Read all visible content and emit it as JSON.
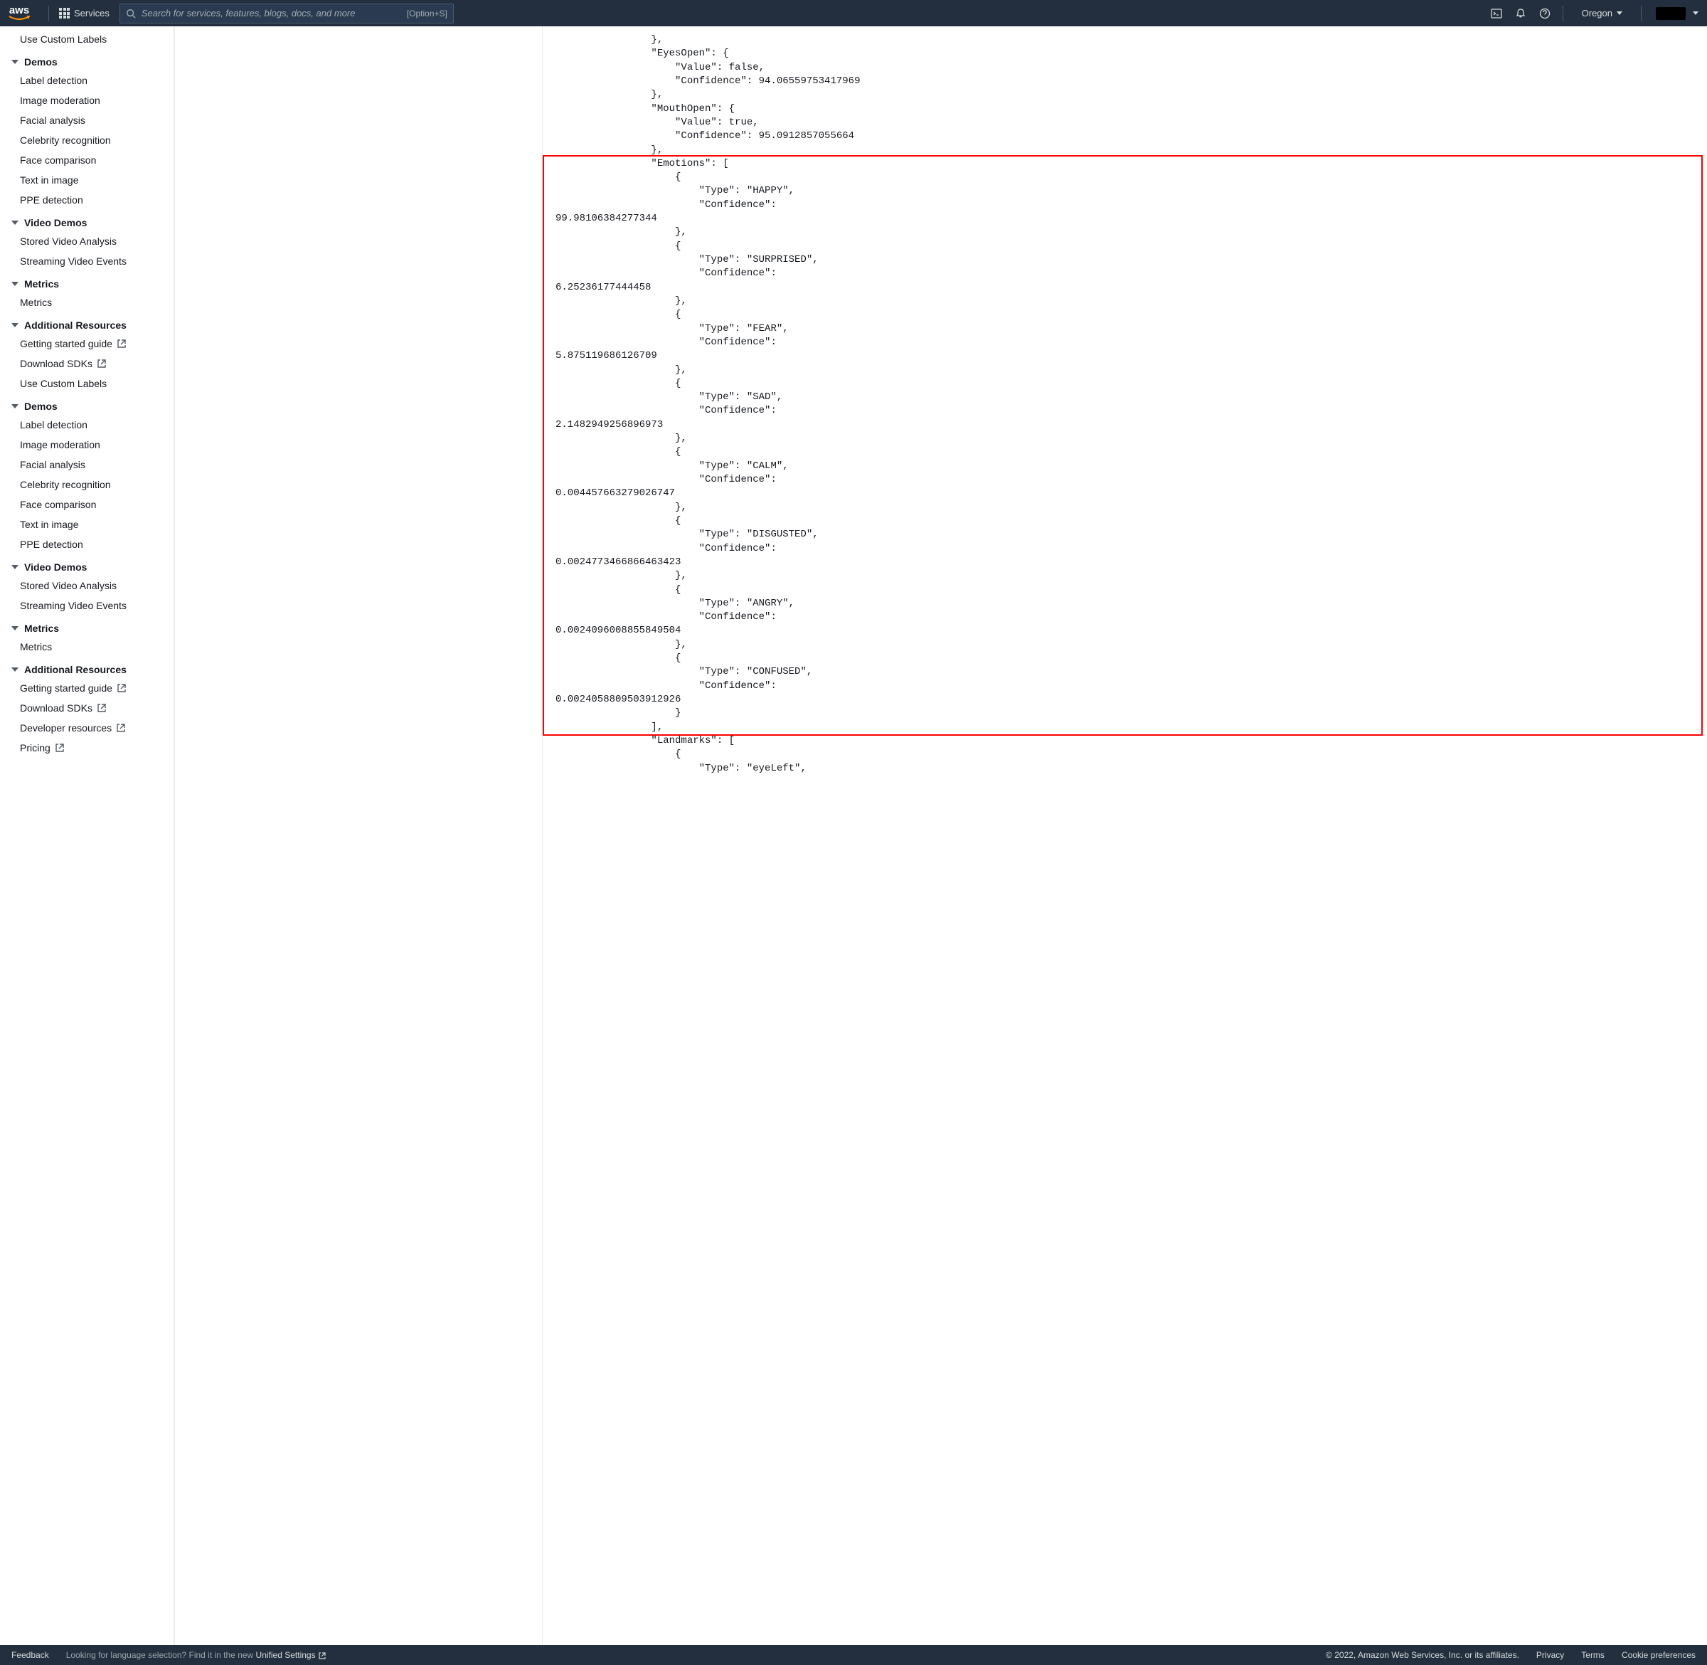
{
  "topnav": {
    "logo_text": "aws",
    "services_label": "Services",
    "search_placeholder": "Search for services, features, blogs, docs, and more",
    "search_hint": "[Option+S]",
    "region": "Oregon"
  },
  "sidebar_sections": [
    {
      "type": "item",
      "label": "Use Custom Labels",
      "ext": false
    },
    {
      "type": "header",
      "label": "Demos"
    },
    {
      "type": "item",
      "label": "Label detection"
    },
    {
      "type": "item",
      "label": "Image moderation"
    },
    {
      "type": "item",
      "label": "Facial analysis"
    },
    {
      "type": "item",
      "label": "Celebrity recognition"
    },
    {
      "type": "item",
      "label": "Face comparison"
    },
    {
      "type": "item",
      "label": "Text in image"
    },
    {
      "type": "item",
      "label": "PPE detection"
    },
    {
      "type": "header",
      "label": "Video Demos"
    },
    {
      "type": "item",
      "label": "Stored Video Analysis"
    },
    {
      "type": "item",
      "label": "Streaming Video Events"
    },
    {
      "type": "header",
      "label": "Metrics"
    },
    {
      "type": "item",
      "label": "Metrics"
    },
    {
      "type": "header",
      "label": "Additional Resources"
    },
    {
      "type": "item",
      "label": "Getting started guide",
      "ext": true
    },
    {
      "type": "item",
      "label": "Download SDKs",
      "ext": true
    },
    {
      "type": "item",
      "label": "Use Custom Labels"
    },
    {
      "type": "header",
      "label": "Demos"
    },
    {
      "type": "item",
      "label": "Label detection"
    },
    {
      "type": "item",
      "label": "Image moderation"
    },
    {
      "type": "item",
      "label": "Facial analysis"
    },
    {
      "type": "item",
      "label": "Celebrity recognition"
    },
    {
      "type": "item",
      "label": "Face comparison"
    },
    {
      "type": "item",
      "label": "Text in image"
    },
    {
      "type": "item",
      "label": "PPE detection"
    },
    {
      "type": "header",
      "label": "Video Demos"
    },
    {
      "type": "item",
      "label": "Stored Video Analysis"
    },
    {
      "type": "item",
      "label": "Streaming Video Events"
    },
    {
      "type": "header",
      "label": "Metrics"
    },
    {
      "type": "item",
      "label": "Metrics"
    },
    {
      "type": "header",
      "label": "Additional Resources"
    },
    {
      "type": "item",
      "label": "Getting started guide",
      "ext": true
    },
    {
      "type": "item",
      "label": "Download SDKs",
      "ext": true
    },
    {
      "type": "item",
      "label": "Developer resources",
      "ext": true
    },
    {
      "type": "item",
      "label": "Pricing",
      "ext": true
    }
  ],
  "json_leading": "                },\n                \"EyesOpen\": {\n                    \"Value\": false,\n                    \"Confidence\": 94.06559753417969\n                },\n                \"MouthOpen\": {\n                    \"Value\": true,\n                    \"Confidence\": 95.0912857055664\n                },\n",
  "json_emotions": "                \"Emotions\": [\n                    {\n                        \"Type\": \"HAPPY\",\n                        \"Confidence\":\n99.98106384277344\n                    },\n                    {\n                        \"Type\": \"SURPRISED\",\n                        \"Confidence\":\n6.25236177444458\n                    },\n                    {\n                        \"Type\": \"FEAR\",\n                        \"Confidence\":\n5.875119686126709\n                    },\n                    {\n                        \"Type\": \"SAD\",\n                        \"Confidence\":\n2.1482949256896973\n                    },\n                    {\n                        \"Type\": \"CALM\",\n                        \"Confidence\":\n0.004457663279026747\n                    },\n                    {\n                        \"Type\": \"DISGUSTED\",\n                        \"Confidence\":\n0.0024773466866463423\n                    },\n                    {\n                        \"Type\": \"ANGRY\",\n                        \"Confidence\":\n0.0024096008855849504\n                    },\n                    {\n                        \"Type\": \"CONFUSED\",\n                        \"Confidence\":\n0.0024058809503912926\n                    }\n                ],",
  "json_trailing": "\n                \"Landmarks\": [\n                    {\n                        \"Type\": \"eyeLeft\",",
  "footer": {
    "feedback": "Feedback",
    "lang_prefix": "Looking for language selection? Find it in the new ",
    "lang_link": "Unified Settings",
    "copyright": "© 2022, Amazon Web Services, Inc. or its affiliates.",
    "privacy": "Privacy",
    "terms": "Terms",
    "cookie": "Cookie preferences"
  }
}
